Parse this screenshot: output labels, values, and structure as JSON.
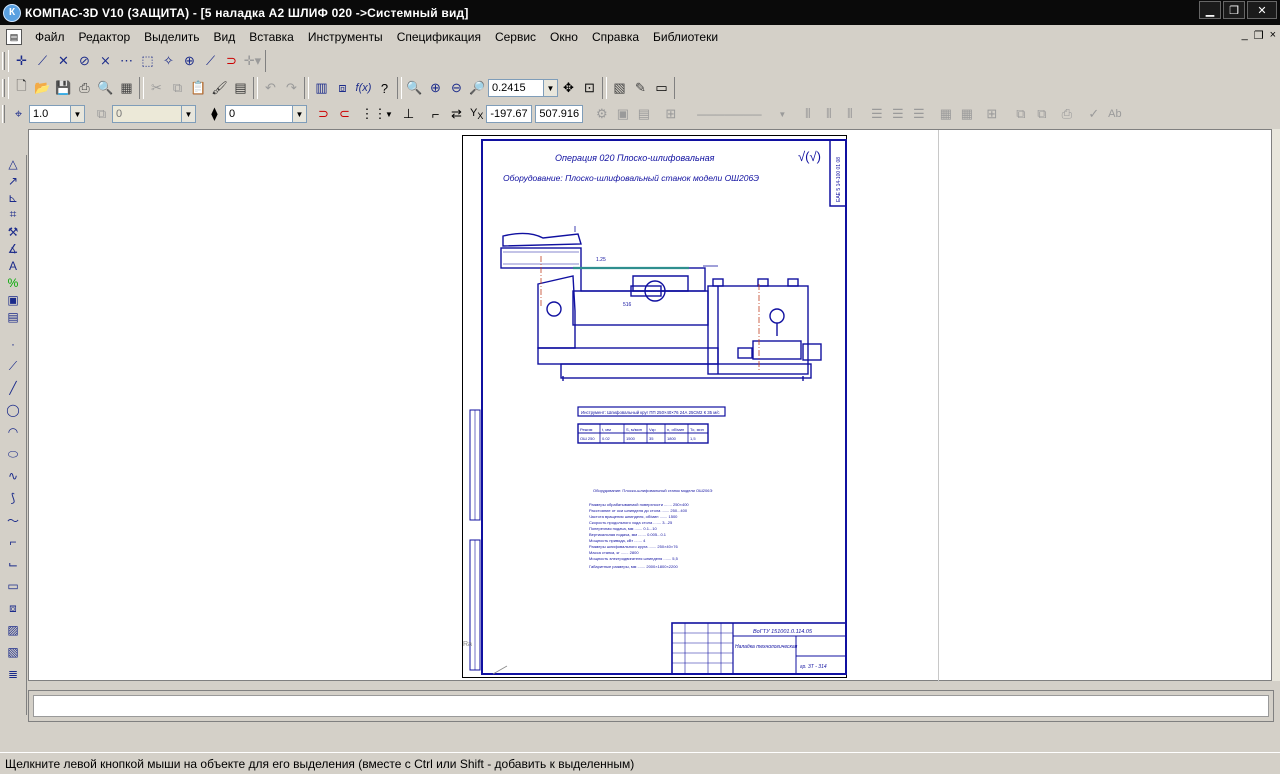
{
  "window": {
    "title": "КОМПАС-3D V10 (ЗАЩИТА) - [5 наладка А2  ШЛИФ 020 ->Системный вид]",
    "app_icon_letter": "К",
    "minimize_label": "▁",
    "maximize_label": "❐",
    "close_label": "✕"
  },
  "menubar": {
    "items": [
      "Файл",
      "Редактор",
      "Выделить",
      "Вид",
      "Вставка",
      "Инструменты",
      "Спецификация",
      "Сервис",
      "Окно",
      "Справка",
      "Библиотеки"
    ],
    "mdi_minimize": "_",
    "mdi_restore": "❐",
    "mdi_close": "×"
  },
  "view_toolbar": {
    "zoom_value": "0.2415"
  },
  "current_params_toolbar": {
    "step_value": "1.0",
    "layer_value": "0",
    "state_value": "0",
    "x_label": "X",
    "y_label": "Y",
    "x_value": "-197.67",
    "y_value": "507.916"
  },
  "drawing": {
    "operation_title": "Операция 020 Плоско-шлифовальная",
    "equipment_line": "Оборудование: Плоско-шлифовальный станок модели ОШ206Э",
    "roughness_mark": "√(√)",
    "roughness_symbol": "√",
    "side_stamp": "ЕАЕ 5 14-100 01 08",
    "tool_line": "Инструмент: Шлифовальный круг ПП 250×40×76 24А 25СМ2 К 35 м/с",
    "table_headers": [
      "Режим",
      "t, мм",
      "S, м/мин",
      "Vкр",
      "n, об/мин",
      "То, мин"
    ],
    "table_values": [
      "ОШ 250",
      "0.02",
      "1500",
      "35",
      "1800",
      "1,5"
    ],
    "tech_notes_title": "Оборудование: Плоско-шлифовальный станок модели ОШ206Э",
    "tech_notes": [
      "Размеры обрабатываемой поверхности ....... 250×400",
      "Расстояние от оси шпинделя до стола ....... 250...400",
      "Частота вращения шпинделя, об/мин ....... 1500",
      "Скорость продольного хода стола ....... 3...25",
      "Поперечная подача, мм ....... 0.1...10",
      "Вертикальная подача, мм ....... 0.005...0.1",
      "Мощность привода, кВт ....... 4",
      "Размеры шлифовального круга ....... 250×40×76",
      "Масса станка, кг ....... 2800",
      "Мощность электродвигателя шпинделя ....... 5,5",
      "Габаритные размеры, мм ....... 2000×1800×2200"
    ],
    "titleblock_code": "ВоГТУ 151001.0.114.05",
    "titleblock_name": "Наладка технологическая",
    "titleblock_group": "гр. 3Т - 314",
    "dim_label_1": "1.25",
    "dim_label_2": "516",
    "coord_readout": "Ra"
  },
  "statusbar": {
    "hint": "Щелкните левой кнопкой мыши на объекте для его выделения (вместе с Ctrl или Shift - добавить к выделенным)"
  },
  "colors": {
    "drawing_blue": "#1010a0",
    "selection_teal": "#2f8f8f",
    "titlebar_bg": "#0a0a0a",
    "chrome_gray": "#d4d0c8"
  }
}
